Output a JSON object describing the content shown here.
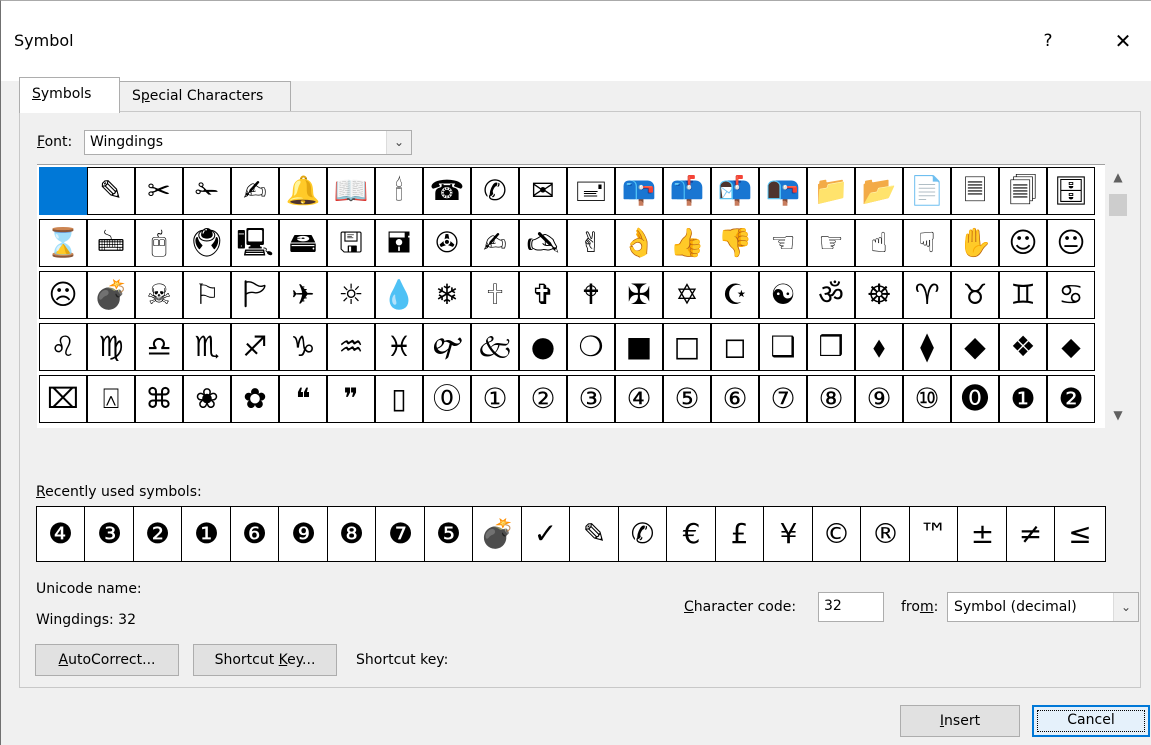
{
  "dialog": {
    "title": "Symbol",
    "help_glyph": "?",
    "close_glyph": "✕"
  },
  "tabs": [
    {
      "label_prefix": "",
      "accel": "S",
      "label_rest": "ymbols"
    },
    {
      "label_prefix": "S",
      "accel": "p",
      "label_rest": "ecial Characters"
    }
  ],
  "font": {
    "label_accel": "F",
    "label_rest": "ont:",
    "value": "Wingdings",
    "dropdown_icon": "⌄"
  },
  "symbols": [
    [
      "",
      "✎",
      "✂",
      "✁",
      "✍",
      "🔔",
      "📖",
      "🕯",
      "☎",
      "✆",
      "✉",
      "🖃",
      "📪",
      "📫",
      "📬",
      "📭",
      "📁",
      "📂",
      "📄",
      "🗏",
      "🗐",
      "🗄"
    ],
    [
      "⌛",
      "🖮",
      "🖰",
      "🖲",
      "🖳",
      "🖴",
      "🖫",
      "🖬",
      "✇",
      "✍",
      "🖎",
      "✌",
      "👌",
      "👍",
      "👎",
      "☜",
      "☞",
      "☝",
      "☟",
      "✋",
      "☺",
      "😐"
    ],
    [
      "☹",
      "💣",
      "☠",
      "⚐",
      "🏱",
      "✈",
      "☼",
      "💧",
      "❄",
      "🕆",
      "✞",
      "🕈",
      "✠",
      "✡",
      "☪",
      "☯",
      "ॐ",
      "☸",
      "♈",
      "♉",
      "♊",
      "♋"
    ],
    [
      "♌",
      "♍",
      "♎",
      "♏",
      "♐",
      "♑",
      "♒",
      "♓",
      "🙰",
      "🙵",
      "●",
      "❍",
      "■",
      "□",
      "◻",
      "❑",
      "❒",
      "⬧",
      "⧫",
      "◆",
      "❖",
      "⬥"
    ],
    [
      "⌧",
      "⍓",
      "⌘",
      "❀",
      "✿",
      "❝",
      "❞",
      "▯",
      "⓪",
      "①",
      "②",
      "③",
      "④",
      "⑤",
      "⑥",
      "⑦",
      "⑧",
      "⑨",
      "⑩",
      "⓿",
      "❶",
      "❷"
    ]
  ],
  "recent": {
    "label_accel": "R",
    "label_rest": "ecently used symbols:",
    "items": [
      "❹",
      "❸",
      "❷",
      "❶",
      "❻",
      "❾",
      "❽",
      "❼",
      "❺",
      "💣",
      "✓",
      "✎",
      "✆",
      "€",
      "£",
      "¥",
      "©",
      "®",
      "™",
      "±",
      "≠",
      "≤"
    ]
  },
  "unicode_name_label": "Unicode name:",
  "unicode_name_value": "Wingdings: 32",
  "char_code": {
    "label_accel": "C",
    "label_rest": "haracter code:",
    "value": "32"
  },
  "from": {
    "label_prefix": "fro",
    "label_accel": "m",
    "label_suffix": ":",
    "value": "Symbol (decimal)"
  },
  "buttons": {
    "autocorrect_accel": "A",
    "autocorrect_rest": "utoCorrect...",
    "shortcut_prefix": "Shortcut ",
    "shortcut_accel": "K",
    "shortcut_rest": "ey...",
    "shortcut_key_label": "Shortcut key:",
    "insert_accel": "I",
    "insert_rest": "nsert",
    "cancel": "Cancel"
  },
  "colors": {
    "selected": "#0078d7",
    "dialog_bg": "#f0f0f0"
  }
}
